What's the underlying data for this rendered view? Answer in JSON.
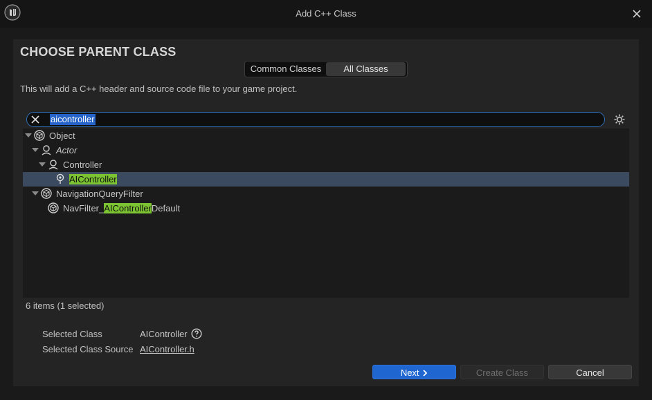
{
  "window": {
    "title": "Add C++ Class"
  },
  "heading": "CHOOSE PARENT CLASS",
  "tabs": [
    {
      "label": "Common Classes",
      "active": false
    },
    {
      "label": "All Classes",
      "active": true
    }
  ],
  "description": "This will add a C++ header and source code file to your game project.",
  "search": {
    "value": "aicontroller"
  },
  "tree": [
    {
      "label": "Object",
      "expanded": true,
      "selected": false
    },
    {
      "label": "Actor",
      "expanded": true,
      "italic": true,
      "selected": false
    },
    {
      "label": "Controller",
      "expanded": true,
      "selected": false
    },
    {
      "label": "AIController",
      "highlight": "AIController",
      "selected": true
    },
    {
      "label": "NavigationQueryFilter",
      "expanded": true,
      "selected": false
    },
    {
      "label_pre": "NavFilter_",
      "label_hl": "AIController",
      "label_post": "Default",
      "selected": false
    }
  ],
  "status": {
    "count_text": "6 items (1 selected)"
  },
  "info": {
    "selected_class_label": "Selected Class",
    "selected_class_value": "AIController",
    "selected_source_label": "Selected Class Source",
    "selected_source_value": "AIController.h"
  },
  "buttons": {
    "next_label": "Next",
    "create_label": "Create Class",
    "cancel_label": "Cancel"
  },
  "colors": {
    "accent": "#1f66d1",
    "highlight": "#7cc432",
    "selection": "#3b4a5e"
  }
}
